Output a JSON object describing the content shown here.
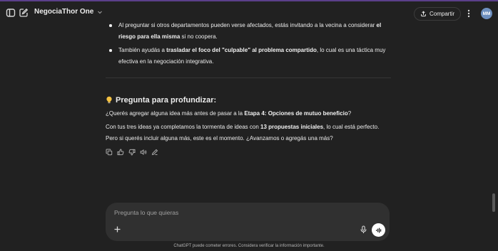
{
  "header": {
    "model_name": "NegociaThor One",
    "share_label": "Compartir",
    "avatar_initials": "MM"
  },
  "message": {
    "bullets": [
      {
        "pre": "Al preguntar si otros departamentos pueden verse afectados, estás invitando a la vecina a considerar ",
        "bold": "el riesgo para ella misma",
        "post": " si no coopera."
      },
      {
        "pre": "También ayudás a ",
        "bold": "trasladar el foco del \"culpable\" al problema compartido",
        "post": ", lo cual es una táctica muy efectiva en la negociación integrativa."
      }
    ],
    "heading": "Pregunta para profundizar:",
    "paragraph1": {
      "pre": "¿Querés agregar alguna idea más antes de pasar a la ",
      "bold": "Etapa 4: Opciones de mutuo beneficio",
      "post": "?"
    },
    "paragraph2": {
      "pre": "Con tus tres ideas ya completamos la tormenta de ideas con ",
      "bold": "13 propuestas iniciales",
      "post": ", lo cual está perfecto. Pero si querés incluir alguna más, este es el momento. ¿Avanzamos o agregás una más?"
    }
  },
  "composer": {
    "placeholder": "Pregunta lo que quieras"
  },
  "footer": {
    "disclaimer": "ChatGPT puede cometer errores. Considera verificar la información importante."
  },
  "icons": {
    "sidebar": "sidebar-toggle-icon",
    "new_chat": "new-chat-icon",
    "share": "share-icon",
    "more": "more-vertical-icon",
    "bulb": "lightbulb-icon",
    "copy": "copy-icon",
    "like": "thumbs-up-icon",
    "dislike": "thumbs-down-icon",
    "read": "speaker-icon",
    "edit": "edit-icon",
    "plus": "plus-icon",
    "mic": "microphone-icon",
    "voice": "voice-mode-icon"
  },
  "colors": {
    "background": "#212121",
    "composer": "#303030",
    "avatar": "#6d8fbf",
    "bulb": "#f5c242"
  }
}
